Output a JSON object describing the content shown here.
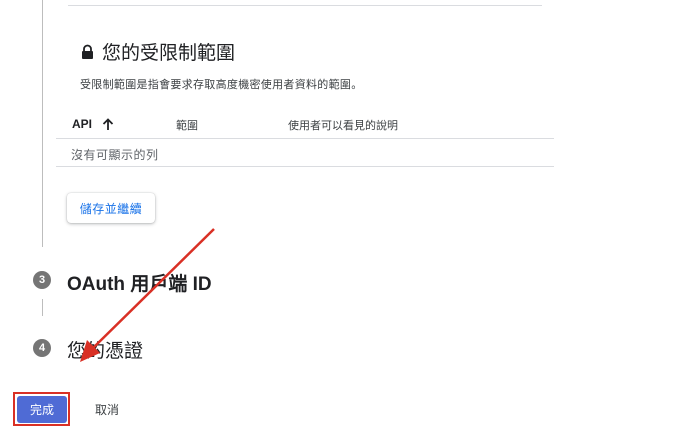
{
  "restricted": {
    "title": "您的受限制範圍",
    "description": "受限制範圍是指會要求存取高度機密使用者資料的範圍。"
  },
  "table": {
    "headers": {
      "api": "API",
      "scope": "範圍",
      "description": "使用者可以看見的說明"
    },
    "empty_message": "沒有可顯示的列"
  },
  "save_button": "儲存並繼續",
  "steps": [
    {
      "number": "3",
      "title": "OAuth 用戶端 ID"
    },
    {
      "number": "4",
      "title": "您的憑證"
    }
  ],
  "actions": {
    "done": "完成",
    "cancel": "取消"
  },
  "colors": {
    "primary_button": "#4f6bd5",
    "link_blue": "#1a73e8",
    "annotation_red": "#d93025",
    "step_badge": "#757575"
  },
  "icons": {
    "lock": "lock-icon",
    "sort": "arrow-up-icon"
  }
}
